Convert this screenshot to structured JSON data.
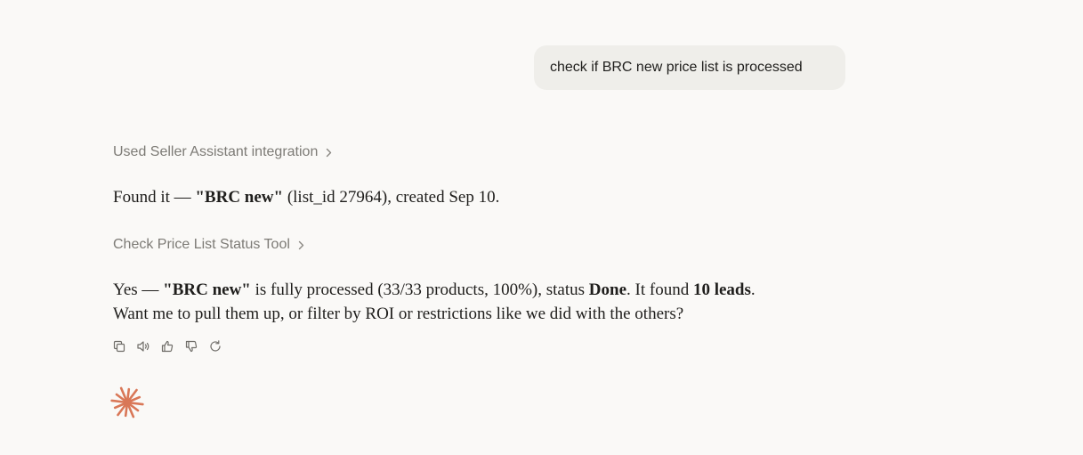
{
  "user_message": "check if BRC new price list is processed",
  "tool_calls": [
    {
      "label": "Used Seller Assistant integration"
    },
    {
      "label": "Check Price List Status Tool"
    }
  ],
  "assistant": {
    "p1": {
      "a": "Found it — ",
      "b": "\"BRC new\"",
      "c": " (list_id 27964), created Sep 10."
    },
    "p2": {
      "a": "Yes — ",
      "b": "\"BRC new\"",
      "c": " is fully processed (33/33 products, 100%), status ",
      "d": "Done",
      "e": ". It found ",
      "f": "10 leads",
      "g": ".",
      "line2": "Want me to pull them up, or filter by ROI or restrictions like we did with the others?"
    }
  },
  "actions": [
    "copy-icon",
    "speaker-icon",
    "thumbs-up-icon",
    "thumbs-down-icon",
    "retry-icon"
  ],
  "colors": {
    "background": "#faf9f7",
    "bubble": "#efeeea",
    "muted_text": "#7d7b76",
    "brand": "#d97757"
  }
}
